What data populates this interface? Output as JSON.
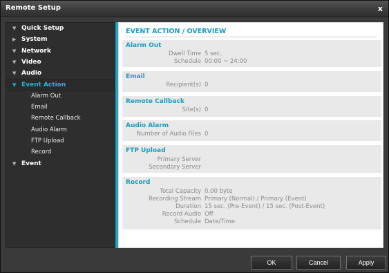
{
  "window": {
    "title": "Remote Setup",
    "close_glyph": "x"
  },
  "sidebar": {
    "items": [
      {
        "label": "Quick Setup",
        "icon": "triangle-down-icon",
        "arrow": "▼"
      },
      {
        "label": "System",
        "icon": "triangle-right-icon",
        "arrow": "▶"
      },
      {
        "label": "Network",
        "icon": "triangle-down-icon",
        "arrow": "▼"
      },
      {
        "label": "Video",
        "icon": "triangle-down-icon",
        "arrow": "▼"
      },
      {
        "label": "Audio",
        "icon": "triangle-down-icon",
        "arrow": "▼"
      },
      {
        "label": "Event Action",
        "icon": "triangle-down-icon",
        "arrow": "▼",
        "selected": true
      },
      {
        "label": "Event",
        "icon": "triangle-down-icon",
        "arrow": "▼"
      }
    ],
    "subitems": [
      "Alarm Out",
      "Email",
      "Remote Callback",
      "Audio Alarm",
      "FTP Upload",
      "Record"
    ]
  },
  "content": {
    "title": "EVENT ACTION / OVERVIEW",
    "sections": {
      "alarm_out": {
        "title": "Alarm Out",
        "rows": [
          {
            "label": "Dwell Time",
            "value": "5 sec."
          },
          {
            "label": "Schedule",
            "value": "00:00 ~ 24:00"
          }
        ]
      },
      "email": {
        "title": "Email",
        "rows": [
          {
            "label": "Recipient(s)",
            "value": "0"
          }
        ]
      },
      "remote_callback": {
        "title": "Remote Callback",
        "rows": [
          {
            "label": "Site(s)",
            "value": "0"
          }
        ]
      },
      "audio_alarm": {
        "title": "Audio Alarm",
        "rows": [
          {
            "label": "Number of Audio Files",
            "value": "0"
          }
        ]
      },
      "ftp_upload": {
        "title": "FTP Upload",
        "rows": [
          {
            "label": "Primary Server",
            "value": ""
          },
          {
            "label": "Secondary Server",
            "value": ""
          }
        ]
      },
      "record": {
        "title": "Record",
        "rows": [
          {
            "label": "Total Capacity",
            "value": "0.00 byte"
          },
          {
            "label": "Recording Stream",
            "value": "Primary (Normal) / Primary (Event)"
          },
          {
            "label": "Duration",
            "value": "15 sec. (Pre-Event) / 15 sec. (Post-Event)"
          },
          {
            "label": "Record Audio",
            "value": "Off"
          },
          {
            "label": "Schedule",
            "value": "Date/Time"
          }
        ]
      }
    }
  },
  "footer": {
    "ok_label": "OK",
    "cancel_label": "Cancel",
    "apply_label": "Apply"
  },
  "colors": {
    "accent": "#1fa6c6",
    "heading": "#1a9bbd",
    "selected_nav": "#26b3d2"
  }
}
